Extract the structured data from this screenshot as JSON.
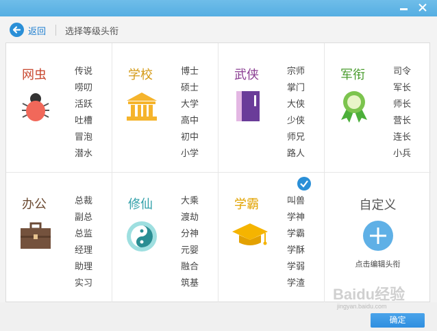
{
  "toolbar": {
    "back_label": "返回",
    "title": "选择等级头衔"
  },
  "categories": [
    {
      "title": "网虫",
      "color": "#c8472f",
      "icon": "bug-icon",
      "tags": [
        "传说",
        "唠叨",
        "活跃",
        "吐槽",
        "冒泡",
        "潜水"
      ]
    },
    {
      "title": "学校",
      "color": "#d49a16",
      "icon": "school-icon",
      "tags": [
        "博士",
        "硕士",
        "大学",
        "高中",
        "初中",
        "小学"
      ]
    },
    {
      "title": "武侠",
      "color": "#8a3d92",
      "icon": "book-icon",
      "tags": [
        "宗师",
        "掌门",
        "大侠",
        "少侠",
        "师兄",
        "路人"
      ]
    },
    {
      "title": "军衔",
      "color": "#4a9c2e",
      "icon": "medal-icon",
      "tags": [
        "司令",
        "军长",
        "师长",
        "营长",
        "连长",
        "小兵"
      ]
    },
    {
      "title": "办公",
      "color": "#6b4a32",
      "icon": "briefcase-icon",
      "tags": [
        "总裁",
        "副总",
        "总监",
        "经理",
        "助理",
        "实习"
      ]
    },
    {
      "title": "修仙",
      "color": "#2f9fa8",
      "icon": "taiji-icon",
      "tags": [
        "大乘",
        "渡劫",
        "分神",
        "元婴",
        "融合",
        "筑基"
      ]
    },
    {
      "title": "学霸",
      "color": "#e2a300",
      "icon": "graduation-cap-icon",
      "tags": [
        "叫兽",
        "学神",
        "学霸",
        "学酥",
        "学弱",
        "学渣"
      ]
    }
  ],
  "custom": {
    "title": "自定义",
    "label": "点击编辑头衔"
  },
  "footer": {
    "ok_label": "确定"
  },
  "watermark": {
    "text": "Baidu经验",
    "sub": "jingyan.baidu.com"
  },
  "colors": {
    "titlebar": "#55aee2",
    "accent": "#2a8fd7"
  }
}
